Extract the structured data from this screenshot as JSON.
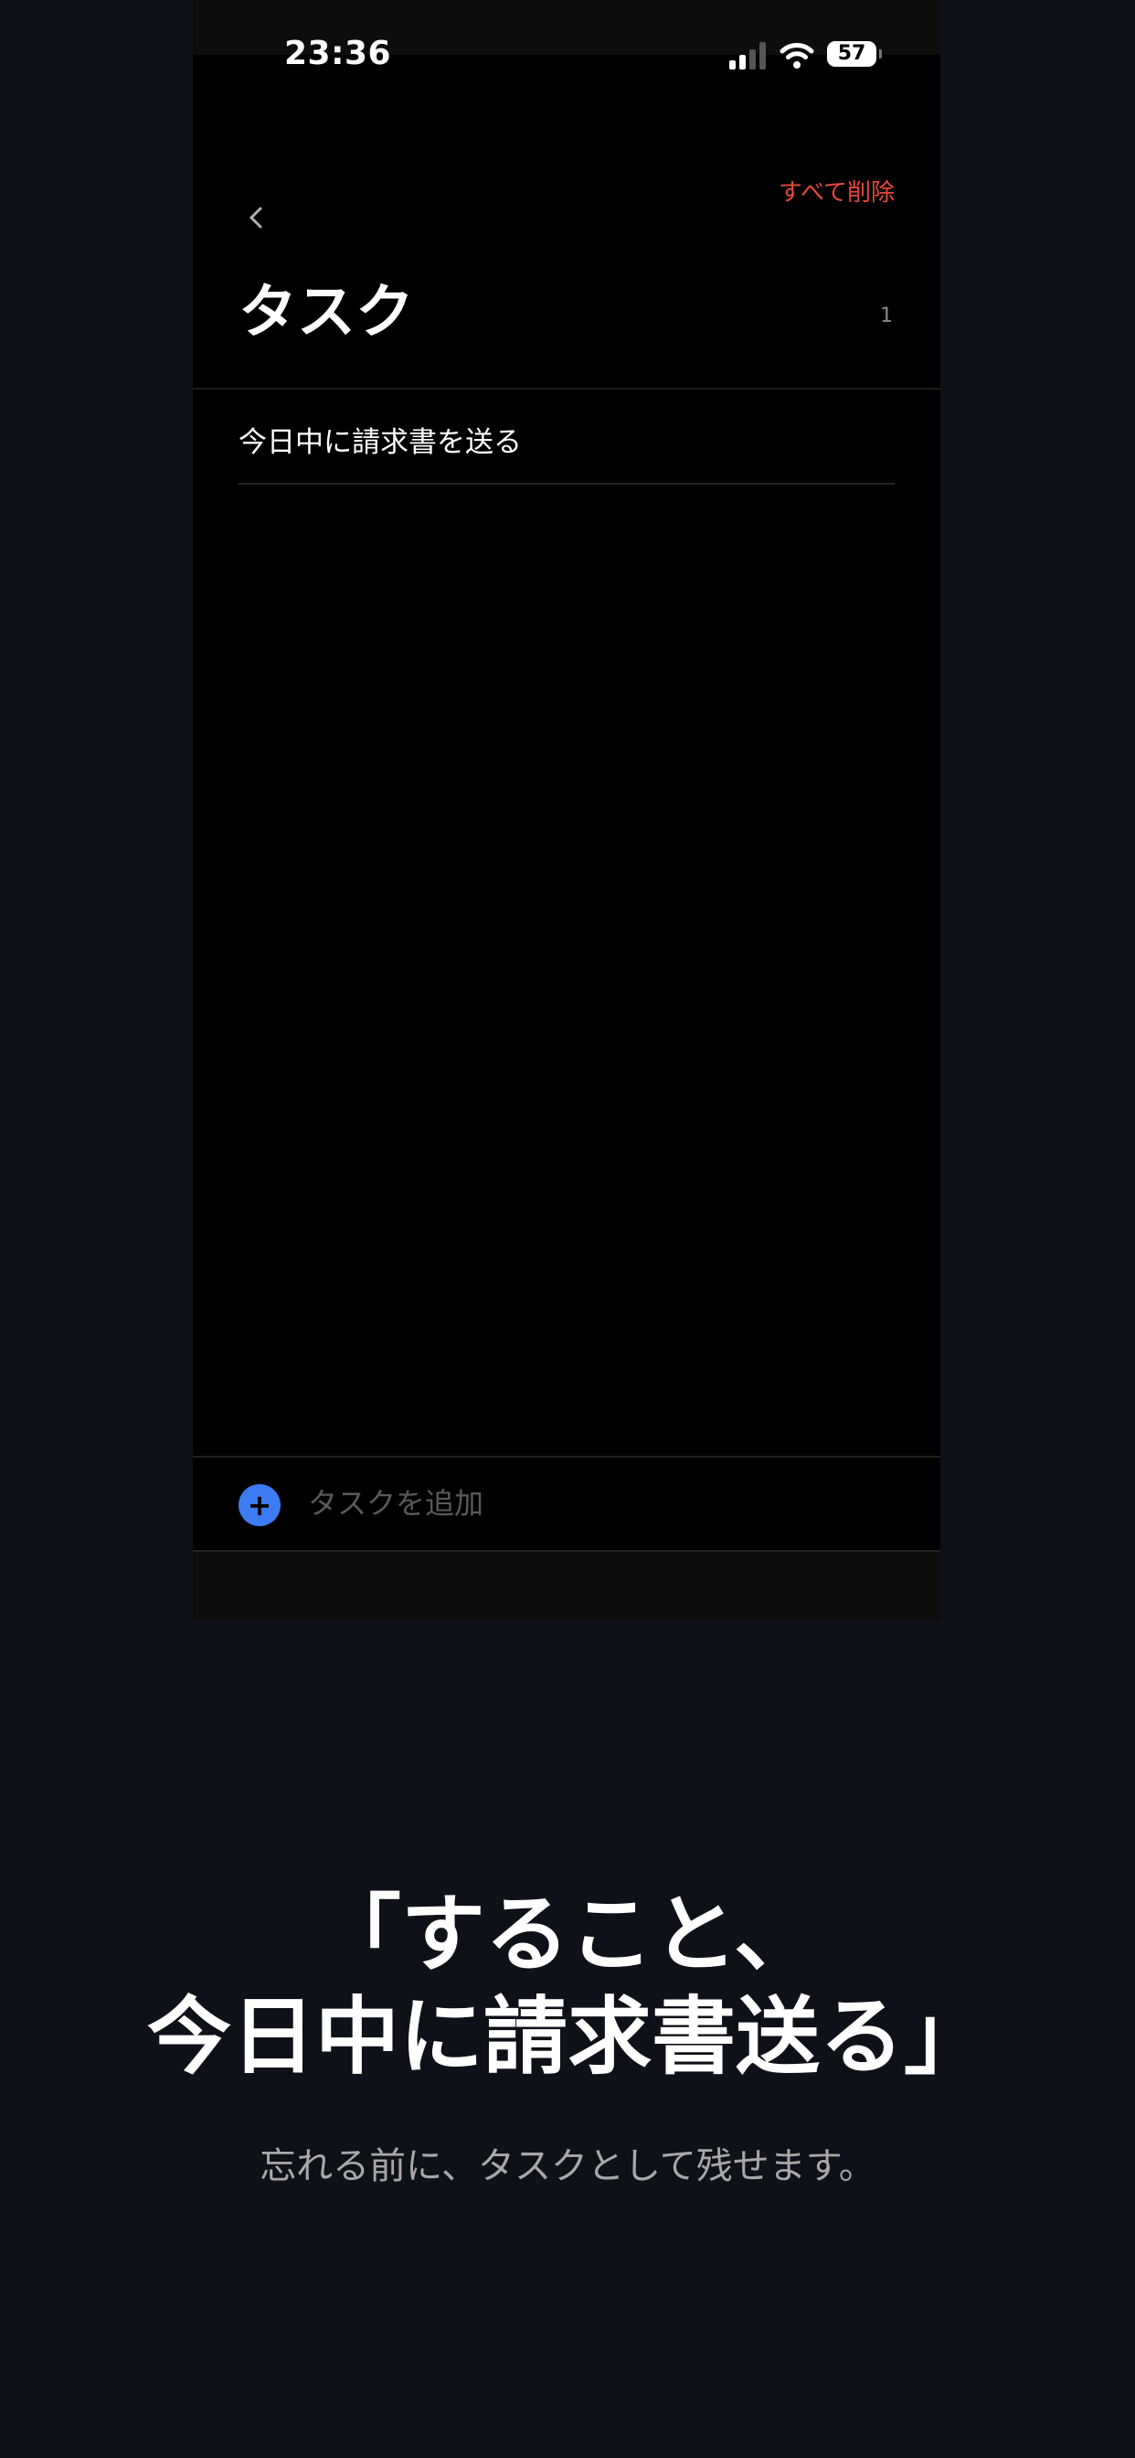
{
  "status_bar": {
    "time": "23:36",
    "battery": "57",
    "icons": [
      "cellular-signal-icon",
      "wifi-icon",
      "battery-icon"
    ]
  },
  "header": {
    "back_icon": "chevron-left-icon",
    "delete_all_label": "すべて削除",
    "title": "タスク",
    "count": "1"
  },
  "tasks": [
    {
      "text": "今日中に請求書を送る"
    }
  ],
  "add_bar": {
    "icon": "plus-icon",
    "placeholder": "タスクを追加"
  },
  "promo": {
    "headline_line1": "「すること、",
    "headline_line2": "今日中に請求書送る」",
    "subtext": "忘れる前に、タスクとして残せます。"
  },
  "colors": {
    "page_background": "#0e1117",
    "app_background": "#000000",
    "danger": "#e5483c",
    "accent": "#3d7bf1"
  }
}
